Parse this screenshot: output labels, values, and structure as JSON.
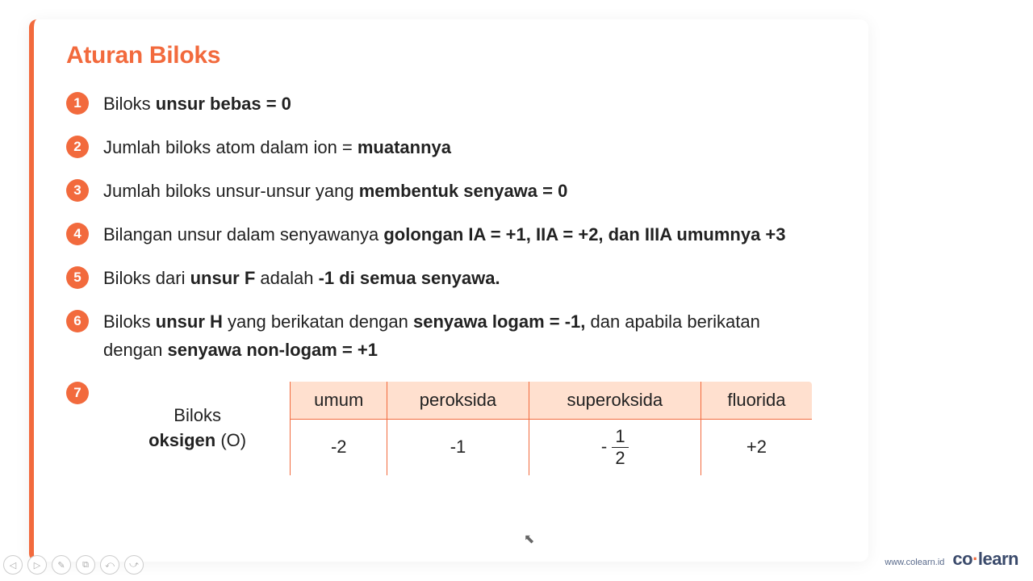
{
  "title": "Aturan Biloks",
  "rules": [
    {
      "n": "1",
      "html": "Biloks <b>unsur bebas = 0</b>"
    },
    {
      "n": "2",
      "html": "Jumlah biloks atom dalam ion = <b>muatannya</b>"
    },
    {
      "n": "3",
      "html": "Jumlah biloks unsur-unsur yang <b>membentuk senyawa = 0</b>"
    },
    {
      "n": "4",
      "html": "Bilangan unsur dalam senyawanya <b>golongan IA = +1, IIA = +2, dan IIIA umumnya +3</b>"
    },
    {
      "n": "5",
      "html": "Biloks dari <b>unsur F</b> adalah <b>-1 di semua senyawa.</b>"
    },
    {
      "n": "6",
      "html": "Biloks <b>unsur H</b> yang berikatan dengan <b>senyawa logam = -1,</b> dan apabila berikatan dengan <b>senyawa non-logam = +1</b>"
    }
  ],
  "table": {
    "row_label_html": "Biloks<br><b>oksigen</b> (O)",
    "headers": [
      "umum",
      "peroksida",
      "superoksida",
      "fluorida"
    ],
    "values": [
      "-2",
      "-1",
      "-1/2",
      "+2"
    ]
  },
  "num7": "7",
  "footer": {
    "site": "www.colearn.id",
    "brand_pre": "co",
    "brand_post": "learn"
  },
  "controls": [
    "◁",
    "▷",
    "✎",
    "⧉",
    "⤺",
    "⤻"
  ],
  "chart_data": {
    "type": "table",
    "title": "Biloks oksigen (O)",
    "categories": [
      "umum",
      "peroksida",
      "superoksida",
      "fluorida"
    ],
    "values": [
      -2,
      -1,
      -0.5,
      2
    ]
  }
}
